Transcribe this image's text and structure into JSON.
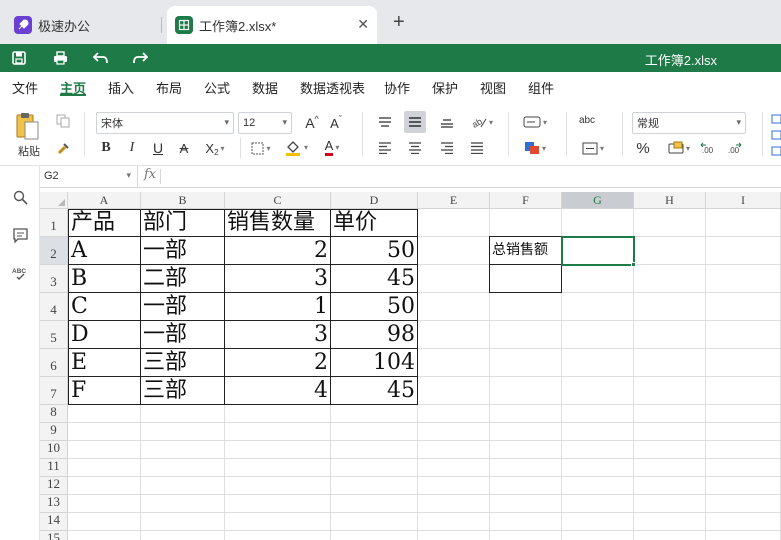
{
  "tabs": [
    {
      "label": "极速办公",
      "icon": "rocket-app-icon",
      "color": "#6a3fd1"
    },
    {
      "label": "工作簿2.xlsx*",
      "icon": "spreadsheet-app-icon",
      "color": "#1e7a46",
      "active": true
    }
  ],
  "window": {
    "doc_title": "工作簿2.xlsx"
  },
  "menu": [
    "文件",
    "主页",
    "插入",
    "布局",
    "公式",
    "数据",
    "数据透视表",
    "协作",
    "保护",
    "视图",
    "组件"
  ],
  "active_menu": "主页",
  "ribbon": {
    "paste_label": "粘贴",
    "font_name": "宋体",
    "font_size": "12",
    "number_format": "常规",
    "grow_font": "A",
    "shrink_font": "A",
    "bold": "B",
    "italic": "I",
    "underline": "U",
    "strike": "A",
    "subscript": "X",
    "font_color": "A",
    "percent": "%",
    "abc": "abc"
  },
  "formula_bar": {
    "name_box": "G2",
    "fx": "fx",
    "formula": ""
  },
  "columns": [
    "A",
    "B",
    "C",
    "D",
    "E",
    "F",
    "G",
    "H",
    "I"
  ],
  "selected_column": "G",
  "rows": [
    "1",
    "2",
    "3",
    "4",
    "5",
    "6",
    "7",
    "8",
    "9",
    "10",
    "11",
    "12",
    "13",
    "14",
    "15"
  ],
  "selected_row": "2",
  "table": {
    "header": [
      "产品",
      "部门",
      "销售数量",
      "单价"
    ],
    "rows": [
      [
        "A",
        "一部",
        "2",
        "50"
      ],
      [
        "B",
        "二部",
        "3",
        "45"
      ],
      [
        "C",
        "一部",
        "1",
        "50"
      ],
      [
        "D",
        "一部",
        "3",
        "98"
      ],
      [
        "E",
        "三部",
        "2",
        "104"
      ],
      [
        "F",
        "三部",
        "4",
        "45"
      ]
    ]
  },
  "side_cell": {
    "label": "总销售额",
    "value": ""
  },
  "colors": {
    "accent": "#1e7a46",
    "fill_highlight": "#f2c200",
    "font_color_bar": "#d0021b"
  }
}
